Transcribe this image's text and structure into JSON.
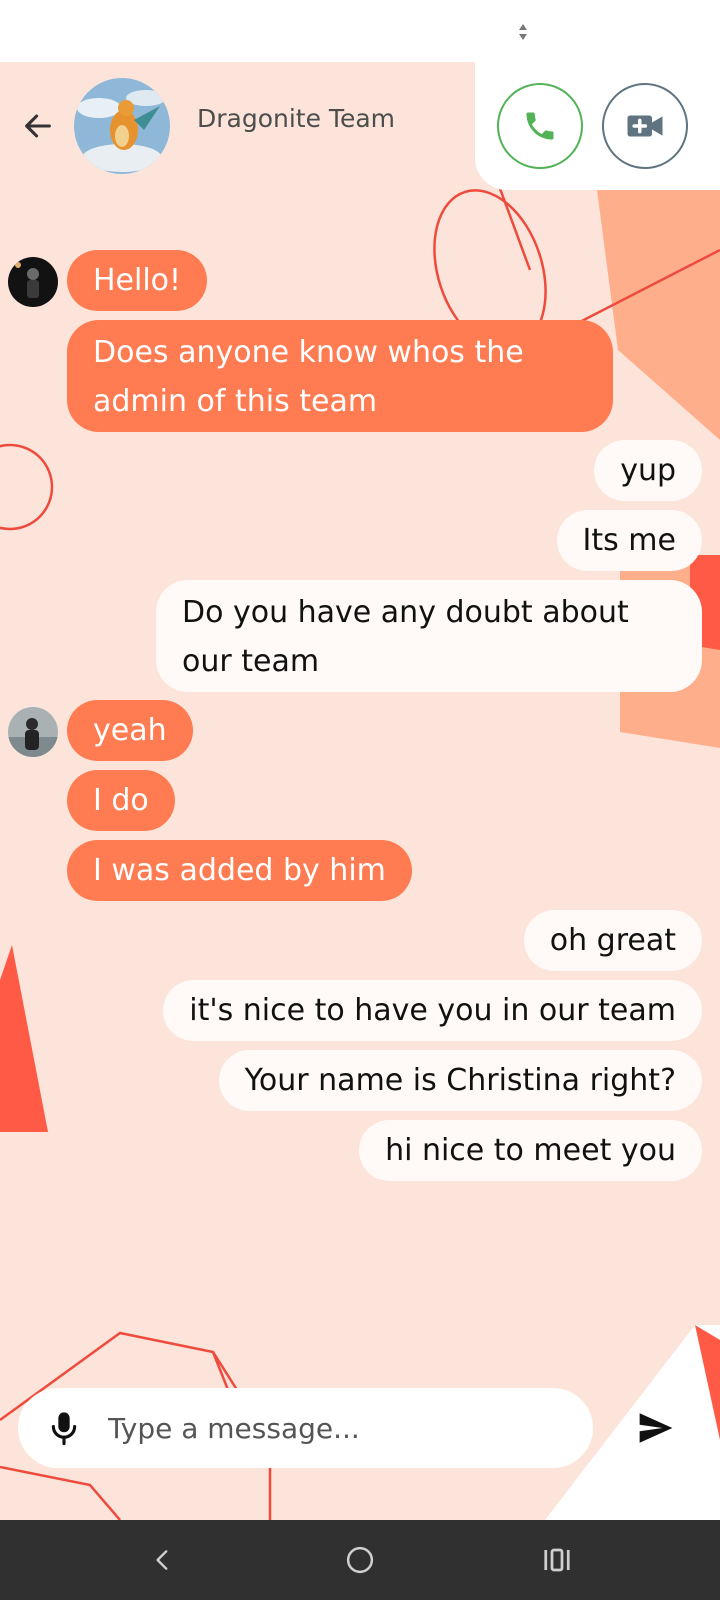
{
  "app": {
    "team_name": "Dragonite Team"
  },
  "header": {
    "back_icon": "arrow-left-icon",
    "call_icon": "phone-icon",
    "video_icon": "video-camera-icon",
    "call_color": "#52b256",
    "video_color": "#5f7380"
  },
  "messages": [
    {
      "sender": "incoming",
      "text": "Hello!"
    },
    {
      "sender": "incoming",
      "text": "Does anyone know whos the"
    },
    {
      "sender": "incoming",
      "text": "admin of this team"
    },
    {
      "sender": "outgoing",
      "text": "yup"
    },
    {
      "sender": "outgoing",
      "text": "Its me"
    },
    {
      "sender": "outgoing",
      "text": "Do you have any doubt about"
    },
    {
      "sender": "outgoing",
      "text": "our team"
    },
    {
      "sender": "incoming",
      "text": "yeah"
    },
    {
      "sender": "incoming",
      "text": "I do"
    },
    {
      "sender": "incoming",
      "text": "I was added by him"
    },
    {
      "sender": "outgoing",
      "text": "oh great"
    },
    {
      "sender": "outgoing",
      "text": "it's nice to have you in our team"
    },
    {
      "sender": "outgoing",
      "text": "Your name is Christina right?"
    },
    {
      "sender": "outgoing",
      "text": "hi nice to meet you"
    }
  ],
  "composer": {
    "placeholder": "Type a message...",
    "value": "",
    "mic_icon": "microphone-icon",
    "send_icon": "send-icon"
  },
  "nav": {
    "back_icon": "chevron-left-icon",
    "home_icon": "circle-home-icon",
    "recents_icon": "recent-apps-icon"
  },
  "colors": {
    "chat_background": "#fde4db",
    "incoming_bubble": "#ff7b52",
    "outgoing_bubble": "#fffaf7",
    "accent_shapes": "#ff5a45"
  }
}
